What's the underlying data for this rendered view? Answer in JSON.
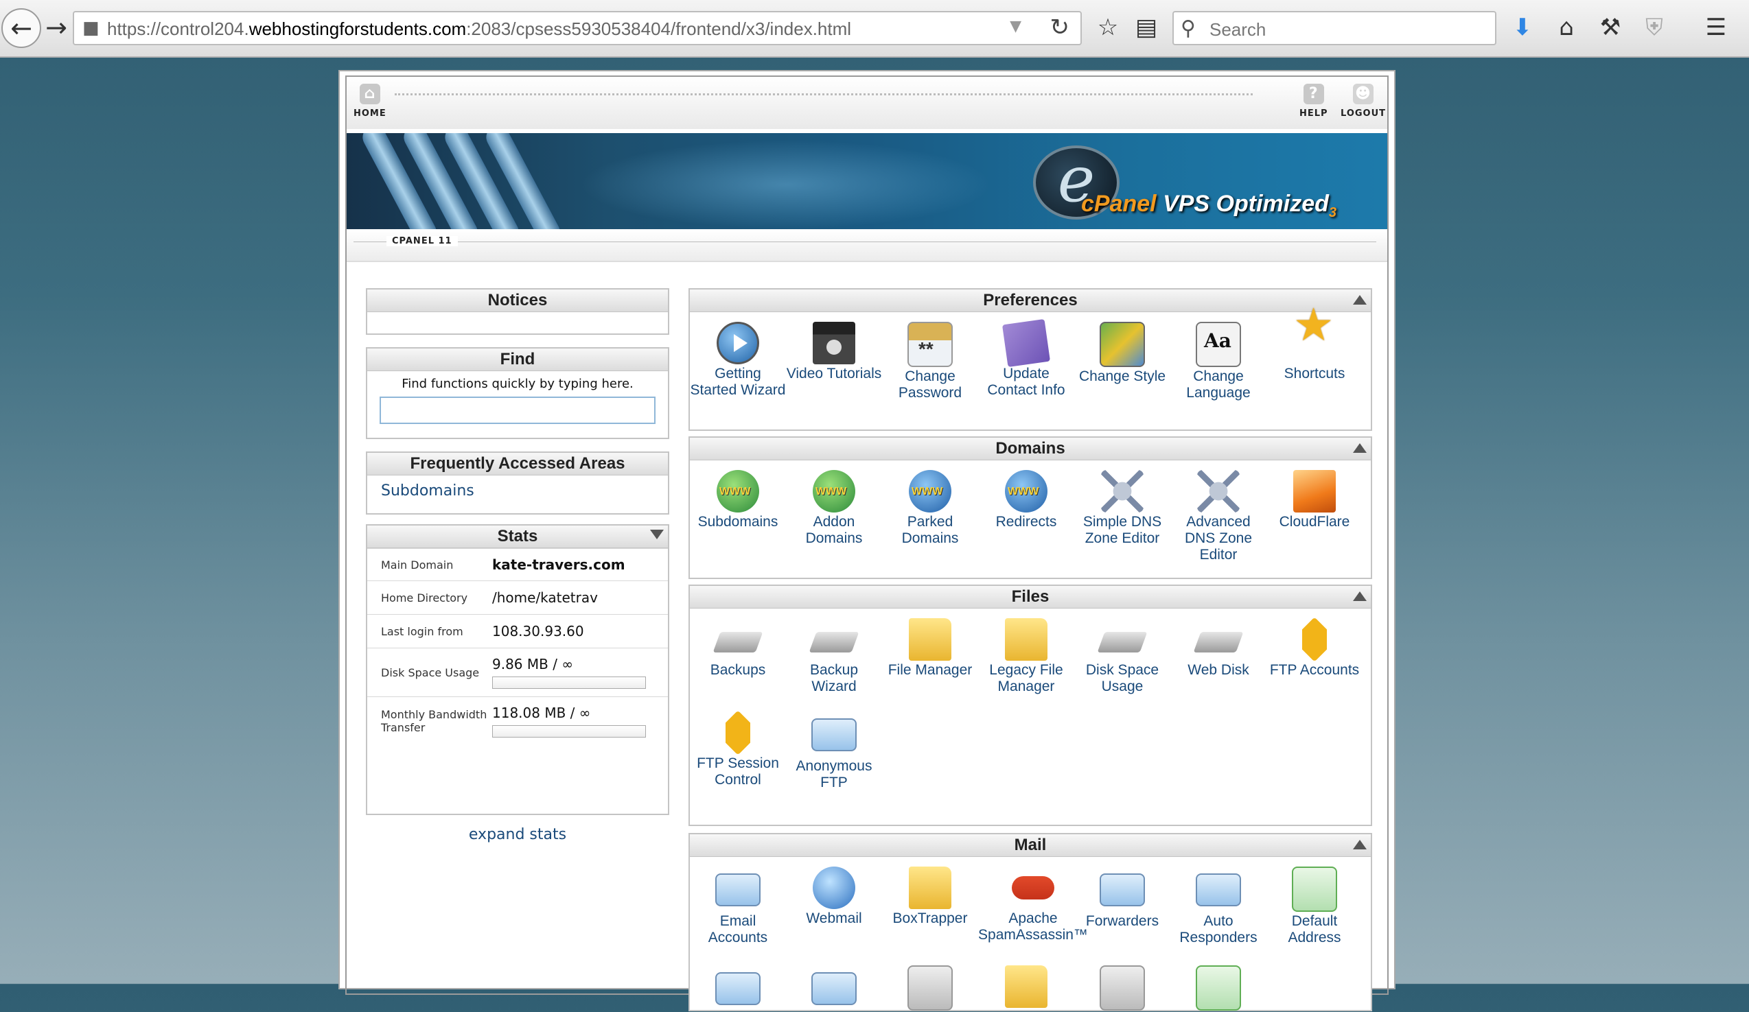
{
  "browser": {
    "url_prefix": "https://control204.",
    "url_domain": "webhostingforstudents.com",
    "url_suffix": ":2083/cpsess5930538404/frontend/x3/index.html",
    "search_placeholder": "Search"
  },
  "topnav": {
    "home": "HOME",
    "help": "HELP",
    "logout": "LOGOUT"
  },
  "banner": {
    "brand": "cPanel",
    "product": "VPS Optimized",
    "version": "3"
  },
  "breadcrumb": "CPANEL 11",
  "notices": {
    "title": "Notices"
  },
  "find": {
    "title": "Find",
    "hint": "Find functions quickly by typing here.",
    "value": ""
  },
  "faa": {
    "title": "Frequently Accessed Areas",
    "link": "Subdomains"
  },
  "stats": {
    "title": "Stats",
    "rows": [
      {
        "label": "Main Domain",
        "value": "kate-travers.com"
      },
      {
        "label": "Home Directory",
        "value": "/home/katetrav"
      },
      {
        "label": "Last login from",
        "value": "108.30.93.60"
      },
      {
        "label": "Disk Space Usage",
        "value": "9.86 MB / ∞",
        "fill": 0
      },
      {
        "label": "Monthly Bandwidth Transfer",
        "value": "118.08 MB / ∞",
        "fill": 0
      }
    ],
    "expand": "expand stats"
  },
  "panels": {
    "preferences": {
      "title": "Preferences",
      "items": [
        {
          "label": "Getting Started Wizard",
          "icon": "play-icon"
        },
        {
          "label": "Video Tutorials",
          "icon": "clapboard-icon"
        },
        {
          "label": "Change Password",
          "icon": "password-icon"
        },
        {
          "label": "Update Contact Info",
          "icon": "contact-icon"
        },
        {
          "label": "Change Style",
          "icon": "style-icon"
        },
        {
          "label": "Change Language",
          "icon": "language-icon"
        },
        {
          "label": "Shortcuts",
          "icon": "star-icon"
        }
      ]
    },
    "domains": {
      "title": "Domains",
      "items": [
        {
          "label": "Subdomains",
          "icon": "www-icon"
        },
        {
          "label": "Addon Domains",
          "icon": "www-add-icon"
        },
        {
          "label": "Parked Domains",
          "icon": "www-stack-icon"
        },
        {
          "label": "Redirects",
          "icon": "www-redirect-icon"
        },
        {
          "label": "Simple DNS Zone Editor",
          "icon": "dns-icon"
        },
        {
          "label": "Advanced DNS Zone Editor",
          "icon": "dns-advanced-icon"
        },
        {
          "label": "CloudFlare",
          "icon": "cloudflare-icon"
        }
      ]
    },
    "files": {
      "title": "Files",
      "items": [
        {
          "label": "Backups",
          "icon": "disk-icon"
        },
        {
          "label": "Backup Wizard",
          "icon": "wand-icon"
        },
        {
          "label": "File Manager",
          "icon": "folder-icon"
        },
        {
          "label": "Legacy File Manager",
          "icon": "folder-legacy-icon"
        },
        {
          "label": "Disk Space Usage",
          "icon": "disk-usage-icon"
        },
        {
          "label": "Web Disk",
          "icon": "webdisk-icon"
        },
        {
          "label": "FTP Accounts",
          "icon": "ftp-icon"
        },
        {
          "label": "FTP Session Control",
          "icon": "ftp-session-icon"
        },
        {
          "label": "Anonymous FTP",
          "icon": "anonymous-ftp-icon"
        }
      ]
    },
    "mail": {
      "title": "Mail",
      "items": [
        {
          "label": "Email Accounts",
          "icon": "envelope-icon"
        },
        {
          "label": "Webmail",
          "icon": "webmail-icon"
        },
        {
          "label": "BoxTrapper",
          "icon": "boxtrapper-icon"
        },
        {
          "label": "Apache SpamAssassin™",
          "icon": "spamassassin-icon"
        },
        {
          "label": "Forwarders",
          "icon": "forwarders-icon"
        },
        {
          "label": "Auto Responders",
          "icon": "autoresponder-icon"
        },
        {
          "label": "Default Address",
          "icon": "default-address-icon"
        }
      ]
    }
  }
}
